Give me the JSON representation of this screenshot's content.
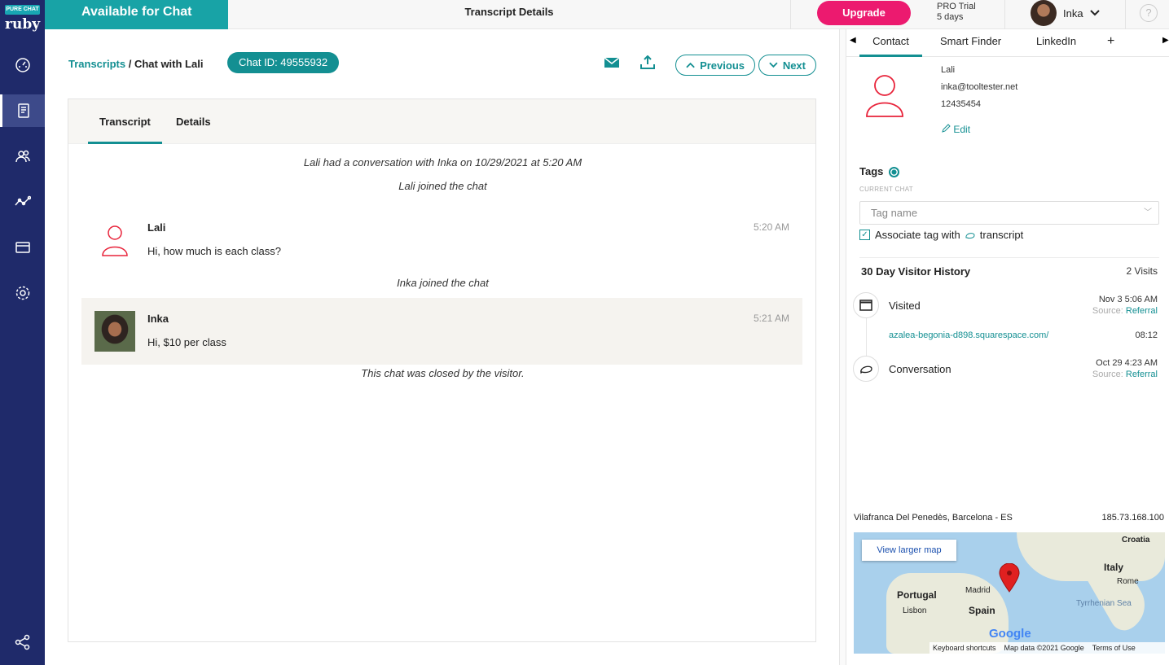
{
  "sidebar": {
    "logo_top": "PURE CHAT",
    "logo_brand": "ruby",
    "items": [
      {
        "name": "dashboard-icon"
      },
      {
        "name": "transcripts-icon"
      },
      {
        "name": "contacts-icon"
      },
      {
        "name": "analytics-icon"
      },
      {
        "name": "widgets-icon"
      },
      {
        "name": "settings-icon"
      },
      {
        "name": "integrations-icon"
      }
    ]
  },
  "topbar": {
    "status": "Available for Chat",
    "title": "Transcript Details",
    "upgrade": "Upgrade",
    "trial_plan": "PRO Trial",
    "trial_days": "5 days",
    "user": "Inka",
    "help": "?"
  },
  "main": {
    "breadcrumb_link": "Transcripts",
    "breadcrumb_sep": " / ",
    "breadcrumb_current": "Chat with Lali",
    "chat_id": "Chat ID: 49555932",
    "previous": "Previous",
    "next": "Next",
    "tabs": [
      "Transcript",
      "Details"
    ],
    "conversation_summary": "Lali had a conversation with Inka on 10/29/2021 at 5:20 AM",
    "events": {
      "lali_joined": "Lali joined the chat",
      "inka_joined": "Inka joined the chat",
      "closed": "This chat was closed by the visitor."
    },
    "messages": [
      {
        "name": "Lali",
        "text": "Hi, how much is each class?",
        "time": "5:20 AM"
      },
      {
        "name": "Inka",
        "text": "Hi, $10 per class",
        "time": "5:21 AM"
      }
    ]
  },
  "right": {
    "tabs": [
      "Contact",
      "Smart Finder",
      "LinkedIn"
    ],
    "add_tab": "+",
    "contact": {
      "name": "Lali",
      "email": "inka@tooltester.net",
      "phone": "12435454",
      "edit": "Edit"
    },
    "tags": {
      "title": "Tags",
      "subtitle": "CURRENT CHAT",
      "placeholder": "Tag name",
      "associate_prefix": "Associate tag with",
      "associate_suffix": "transcript"
    },
    "history": {
      "title": "30 Day Visitor History",
      "count": "2 Visits",
      "items": [
        {
          "label": "Visited",
          "date": "Nov 3 5:06 AM",
          "source_label": "Source:",
          "source": "Referral"
        },
        {
          "label": "Conversation",
          "date": "Oct 29 4:23 AM",
          "source_label": "Source:",
          "source": "Referral"
        }
      ],
      "url": "azalea-begonia-d898.squarespace.com/",
      "url_time": "08:12"
    },
    "location": "Vilafranca Del Penedès, Barcelona - ES",
    "ip": "185.73.168.100",
    "map": {
      "view_larger": "View larger map",
      "labels": {
        "croatia": "Croatia",
        "italy": "Italy",
        "rome": "Rome",
        "portugal": "Portugal",
        "madrid": "Madrid",
        "spain": "Spain",
        "lisbon": "Lisbon",
        "tyrrhenian": "Tyrrhenian Sea"
      },
      "google": "Google",
      "shortcuts": "Keyboard shortcuts",
      "mapdata": "Map data ©2021 Google",
      "terms": "Terms of Use"
    }
  },
  "colors": {
    "teal": "#138f92",
    "sidebar": "#1f2a6a",
    "upgrade": "#ec1a6f",
    "avatar_red": "#e8233a"
  }
}
